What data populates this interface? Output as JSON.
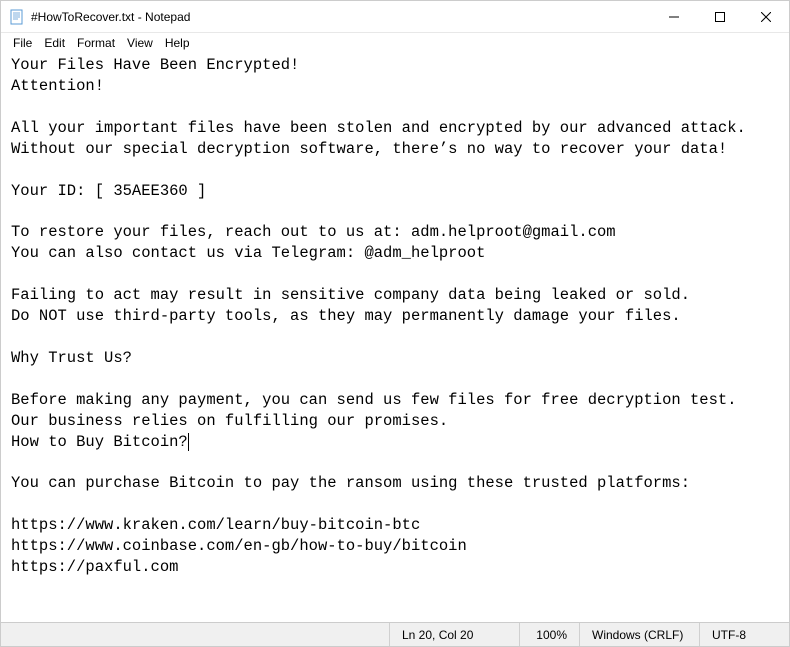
{
  "titlebar": {
    "title": "#HowToRecover.txt - Notepad"
  },
  "menu": {
    "file": "File",
    "edit": "Edit",
    "format": "Format",
    "view": "View",
    "help": "Help"
  },
  "content": {
    "text": "Your Files Have Been Encrypted!\nAttention!\n\nAll your important files have been stolen and encrypted by our advanced attack.\nWithout our special decryption software, there’s no way to recover your data!\n\nYour ID: [ 35AEE360 ]\n\nTo restore your files, reach out to us at: adm.helproot@gmail.com\nYou can also contact us via Telegram: @adm_helproot\n\nFailing to act may result in sensitive company data being leaked or sold.\nDo NOT use third-party tools, as they may permanently damage your files.\n\nWhy Trust Us?\n\nBefore making any payment, you can send us few files for free decryption test.\nOur business relies on fulfilling our promises.\n",
    "cursor_line": "How to Buy Bitcoin?",
    "text_after": "\n\nYou can purchase Bitcoin to pay the ransom using these trusted platforms:\n\nhttps://www.kraken.com/learn/buy-bitcoin-btc\nhttps://www.coinbase.com/en-gb/how-to-buy/bitcoin\nhttps://paxful.com"
  },
  "statusbar": {
    "position": "Ln 20, Col 20",
    "zoom": "100%",
    "eol": "Windows (CRLF)",
    "encoding": "UTF-8"
  }
}
